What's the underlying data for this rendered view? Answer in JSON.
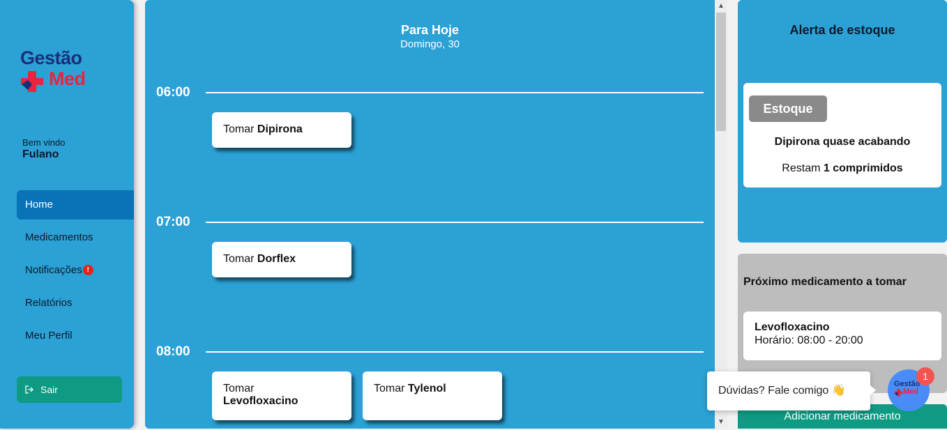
{
  "sidebar": {
    "logo_line1": "Gestão",
    "logo_line2": "Med",
    "welcome": "Bem vindo",
    "username": "Fulano",
    "items": [
      {
        "label": "Home"
      },
      {
        "label": "Medicamentos"
      },
      {
        "label": "Notificações",
        "badge": "!"
      },
      {
        "label": "Relatórios"
      },
      {
        "label": "Meu Perfil"
      }
    ],
    "logout_label": "Sair",
    "logout_icon": "logout-icon"
  },
  "main": {
    "title": "Para Hoje",
    "subtitle": "Domingo, 30",
    "slots": [
      {
        "time": "06:00",
        "items": [
          {
            "prefix": "Tomar",
            "med": "Dipirona"
          }
        ]
      },
      {
        "time": "07:00",
        "items": [
          {
            "prefix": "Tomar",
            "med": "Dorflex"
          }
        ]
      },
      {
        "time": "08:00",
        "items": [
          {
            "prefix": "Tomar",
            "med": "Levofloxacino"
          },
          {
            "prefix": "Tomar",
            "med": "Tylenol"
          }
        ]
      }
    ]
  },
  "stock_alert": {
    "title": "Alerta de estoque",
    "button": "Estoque",
    "message": "Dipirona quase acabando",
    "remaining_prefix": "Restam",
    "remaining_value": "1 comprimidos"
  },
  "next_med": {
    "title": "Próximo medicamento a tomar",
    "name": "Levofloxacino",
    "schedule": "Horário: 08:00 - 20:00"
  },
  "add_button": "Adicionar medicamento",
  "chat": {
    "text": "Dúvidas? Fale comigo 👋",
    "avatar_line1": "Gestão",
    "avatar_line2": "Med",
    "count": "1"
  },
  "colors": {
    "panel_blue": "#2ba1d6",
    "active_blue": "#0a72b6",
    "teal": "#0f9a83",
    "brand_navy": "#18307a",
    "brand_red": "#e8243e"
  }
}
